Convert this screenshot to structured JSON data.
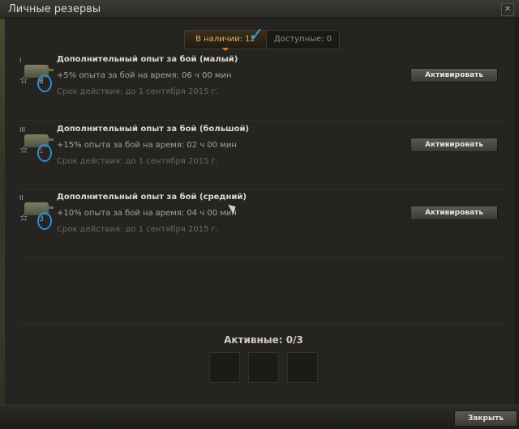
{
  "window": {
    "title": "Личные резервы"
  },
  "tabs": [
    {
      "label": "В наличии: 12"
    },
    {
      "label": "Доступные: 0"
    }
  ],
  "reserves": [
    {
      "name": "Дополнительный опыт за бой (малый)",
      "description": "+5% опыта за бой на время: 06 ч 00 мин",
      "expiry": "Срок действия: до 1 сентября 2015 г.",
      "tier": "I",
      "count": "8",
      "button": "Активировать"
    },
    {
      "name": "Дополнительный опыт за бой (большой)",
      "description": "+15% опыта за бой на время: 02 ч 00 мин",
      "expiry": "Срок действия: до 1 сентября 2015 г.",
      "tier": "III",
      "count": "1",
      "button": "Активировать"
    },
    {
      "name": "Дополнительный опыт за бой (средний)",
      "description": "+10% опыта за бой на время: 04 ч 00 мин",
      "expiry": "Срок действия: до 1 сентября 2015 г.",
      "tier": "II",
      "count": "3",
      "button": "Активировать"
    }
  ],
  "active": {
    "label": "Активные: 0/3",
    "slots": 3
  },
  "footer": {
    "close_label": "Закрыть"
  },
  "colors": {
    "accent": "#e0b26a",
    "annotation": "#2a8fd6"
  },
  "icons": [
    "tank-icon",
    "star-icon",
    "close-icon",
    "checkmark-annotation"
  ]
}
